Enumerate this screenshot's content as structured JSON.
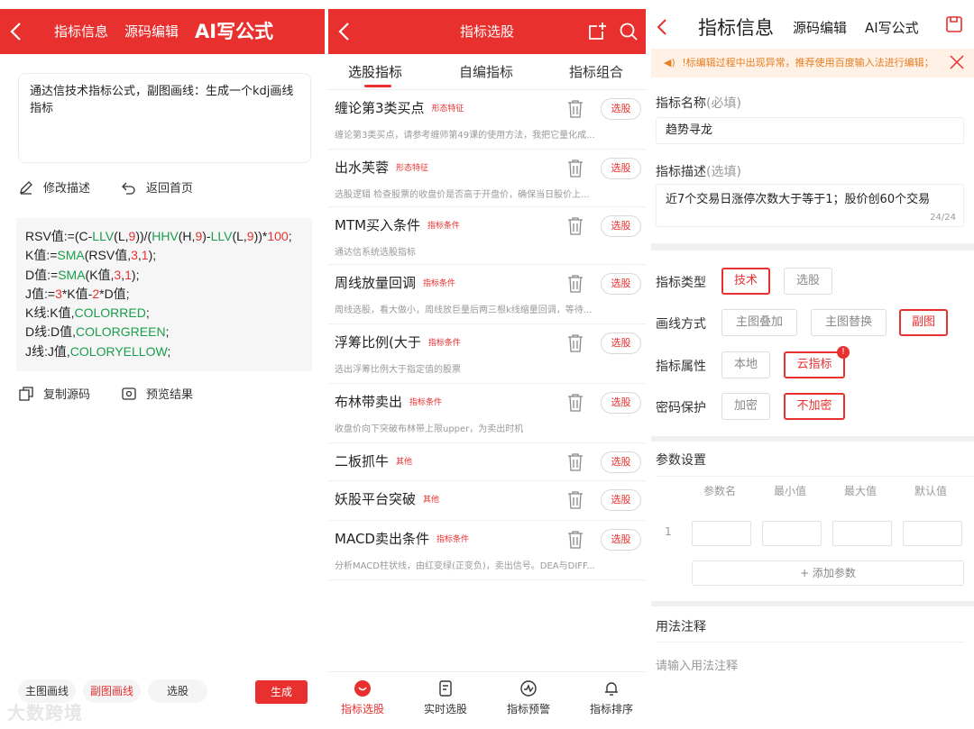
{
  "panel1": {
    "header": {
      "tab1": "指标信息",
      "tab2": "源码编辑",
      "title": "AI写公式"
    },
    "description": "通达信技术指标公式，副图画线：生成一个kdj画线指标",
    "actions": {
      "edit": "修改描述",
      "home": "返回首页",
      "copy": "复制源码",
      "preview": "预览结果"
    },
    "code_lines": [
      "RSV值:=(C-LLV(L,9))/(HHV(H,9)-LLV(L,9))*100;",
      "K值:=SMA(RSV值,3,1);",
      "D值:=SMA(K值,3,1);",
      "J值:=3*K值-2*D值;",
      "K线:K值,COLORRED;",
      "D线:D值,COLORGREEN;",
      "J线:J值,COLORYELLOW;"
    ],
    "bottom": {
      "main_line": "主图画线",
      "sub_line": "副图画线",
      "select": "选股",
      "generate": "生成"
    },
    "watermark": "大数跨境"
  },
  "panel2": {
    "title": "指标选股",
    "tabs": [
      "选股指标",
      "自编指标",
      "指标组合"
    ],
    "select_label": "选股",
    "items": [
      {
        "title": "缠论第3类买点",
        "tag": "形态特征",
        "desc": "缠论第3类买点，请参考缠师第49课的使用方法，我把它量化成..."
      },
      {
        "title": "出水芙蓉",
        "tag": "形态特征",
        "desc": "选股逻辑 检查股票的收盘价是否高于开盘价，确保当日股价上..."
      },
      {
        "title": "MTM买入条件",
        "tag": "指标条件",
        "desc": "通达信系统选股指标"
      },
      {
        "title": "周线放量回调",
        "tag": "指标条件",
        "desc": "周线选股，看大做小，周线放巨量后两三根k线缩量回调，等待..."
      },
      {
        "title": "浮筹比例(大于",
        "tag": "指标条件",
        "desc": "选出浮筹比例大于指定值的股票"
      },
      {
        "title": "布林带卖出",
        "tag": "指标条件",
        "desc": "收盘价向下突破布林带上限upper，为卖出时机"
      },
      {
        "title": "二板抓牛",
        "tag": "其他",
        "desc": ""
      },
      {
        "title": "妖股平台突破",
        "tag": "其他",
        "desc": ""
      },
      {
        "title": "MACD卖出条件",
        "tag": "指标条件",
        "desc": "分析MACD柱状线，由红变绿(正变负)，卖出信号。DEA与DIFF..."
      }
    ],
    "nav": [
      "指标选股",
      "实时选股",
      "指标预警",
      "指标排序"
    ]
  },
  "panel3": {
    "header": {
      "title": "指标信息",
      "tab2": "源码编辑",
      "tab3": "AI写公式"
    },
    "notice": "!标编辑过程中出现异常，推荐使用百度输入法进行编辑；",
    "name_label": "指标名称",
    "name_hint": "(必填)",
    "name_value": "趋势寻龙",
    "desc_label": "指标描述",
    "desc_hint": "(选填)",
    "desc_value": "近7个交易日涨停次数大于等于1；股价创60个交易",
    "desc_count": "24/24",
    "type_label": "指标类型",
    "type_options": [
      "技术",
      "选股"
    ],
    "draw_label": "画线方式",
    "draw_options": [
      "主图叠加",
      "主图替换",
      "副图"
    ],
    "attr_label": "指标属性",
    "attr_options": [
      "本地",
      "云指标"
    ],
    "attr_badge": "!",
    "pwd_label": "密码保护",
    "pwd_options": [
      "加密",
      "不加密"
    ],
    "params_title": "参数设置",
    "param_headers": [
      "参数名",
      "最小值",
      "最大值",
      "默认值"
    ],
    "param_row_index": "1",
    "add_param": "+ 添加参数",
    "usage_title": "用法注释",
    "usage_placeholder": "请输入用法注释"
  }
}
